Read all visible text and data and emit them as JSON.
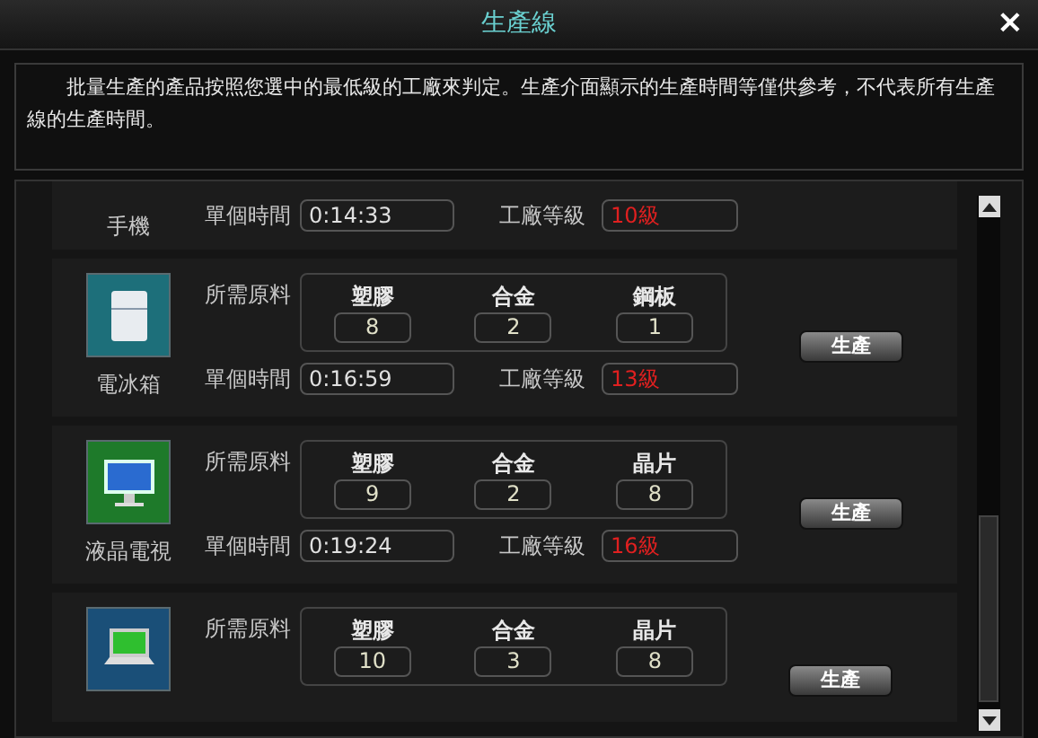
{
  "window": {
    "title": "生產線",
    "close": "×"
  },
  "notice": "批量生產的產品按照您選中的最低級的工廠來判定。生產介面顯示的生產時間等僅供參考，不代表所有生產線的生產時間。",
  "products": [
    {
      "kind": "partial",
      "name": "手機",
      "time_label": "單個時間",
      "time": "0:14:33",
      "level_label": "工廠等級",
      "level_text": "10級"
    },
    {
      "kind": "full",
      "name": "電冰箱",
      "materials_label": "所需原料",
      "materials": [
        {
          "name": "塑膠",
          "qty": "8"
        },
        {
          "name": "合金",
          "qty": "2"
        },
        {
          "name": "鋼板",
          "qty": "1"
        }
      ],
      "button": "生產",
      "time_label": "單個時間",
      "time": "0:16:59",
      "level_label": "工廠等級",
      "level_text": "13級"
    },
    {
      "kind": "full",
      "name": "液晶電視",
      "materials_label": "所需原料",
      "materials": [
        {
          "name": "塑膠",
          "qty": "9"
        },
        {
          "name": "合金",
          "qty": "2"
        },
        {
          "name": "晶片",
          "qty": "8"
        }
      ],
      "button": "生產",
      "time_label": "單個時間",
      "time": "0:19:24",
      "level_label": "工廠等級",
      "level_text": "16級"
    },
    {
      "kind": "top",
      "materials_label": "所需原料",
      "materials": [
        {
          "name": "塑膠",
          "qty": "10"
        },
        {
          "name": "合金",
          "qty": "3"
        },
        {
          "name": "晶片",
          "qty": "8"
        }
      ],
      "button": "生產"
    }
  ]
}
